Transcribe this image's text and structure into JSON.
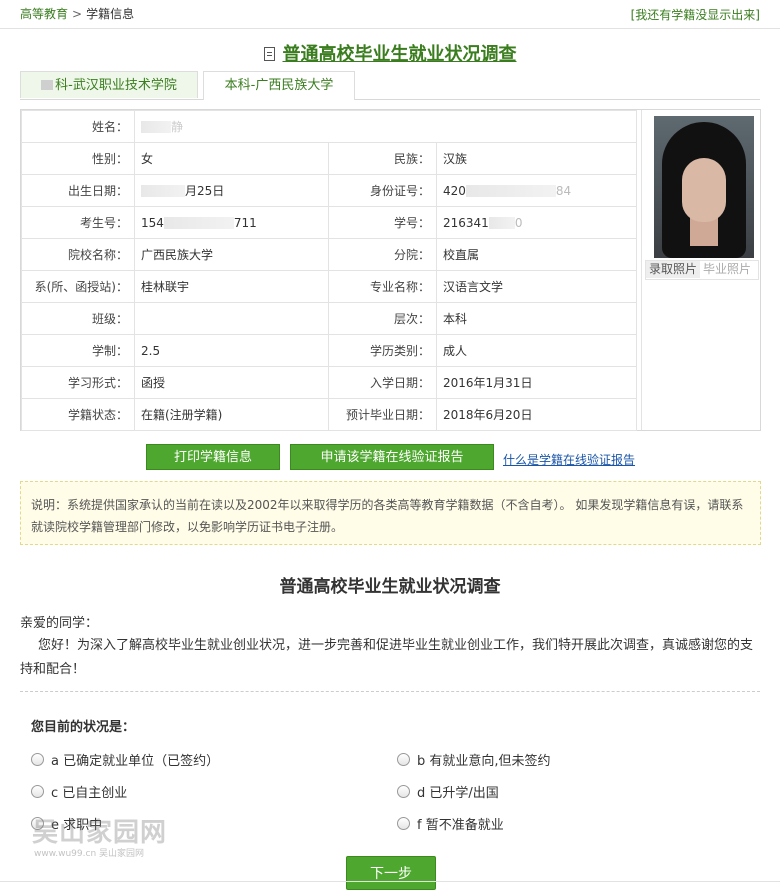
{
  "breadcrumb": {
    "root": "高等教育",
    "separator": ">",
    "current": "学籍信息"
  },
  "missing_link": "[我还有学籍没显示出来]",
  "page_title": "普通高校毕业生就业状况调查",
  "tabs": [
    {
      "label": "科-武汉职业技术学院"
    },
    {
      "label": "本科-广西民族大学"
    }
  ],
  "info": {
    "name_label": "姓名：",
    "name_value": "静",
    "gender_label": "性别：",
    "gender_value": "女",
    "ethnicity_label": "民族：",
    "ethnicity_value": "汉族",
    "birth_label": "出生日期：",
    "birth_value": "月25日",
    "id_label": "身份证号：",
    "id_prefix": "420",
    "id_suffix": "84",
    "exam_label": "考生号：",
    "exam_prefix": "154",
    "exam_suffix": "711",
    "student_no_label": "学号：",
    "student_no_prefix": "216341",
    "student_no_suffix": "0",
    "school_label": "院校名称：",
    "school_value": "广西民族大学",
    "branch_label": "分院：",
    "branch_value": "校直属",
    "dept_label": "系(所、函授站)：",
    "dept_value": "桂林联宇",
    "major_label": "专业名称：",
    "major_value": "汉语言文学",
    "class_label": "班级：",
    "class_value": "",
    "level_label": "层次：",
    "level_value": "本科",
    "duration_label": "学制：",
    "duration_value": "2.5",
    "edu_type_label": "学历类别：",
    "edu_type_value": "成人",
    "study_form_label": "学习形式：",
    "study_form_value": "函授",
    "enroll_label": "入学日期：",
    "enroll_value": "2016年1月31日",
    "status_label": "学籍状态：",
    "status_value": "在籍(注册学籍)",
    "grad_label": "预计毕业日期：",
    "grad_value": "2018年6月20日"
  },
  "photo_tabs": {
    "admission": "录取照片",
    "graduation": "毕业照片"
  },
  "buttons": {
    "print": "打印学籍信息",
    "verify": "申请该学籍在线验证报告",
    "what_is": "什么是学籍在线验证报告"
  },
  "notice": "说明：系统提供国家承认的当前在读以及2002年以来取得学历的各类高等教育学籍数据（不含自考）。 如果发现学籍信息有误，请联系就读院校学籍管理部门修改，以免影响学历证书电子注册。",
  "survey": {
    "title": "普通高校毕业生就业状况调查",
    "greeting": "亲爱的同学：",
    "intro": "您好！为深入了解高校毕业生就业创业状况，进一步完善和促进毕业生就业创业工作，我们特开展此次调查，真诚感谢您的支持和配合！",
    "question": "您目前的状况是：",
    "options": [
      {
        "label": "a 已确定就业单位（已签约）"
      },
      {
        "label": "b 有就业意向,但未签约"
      },
      {
        "label": "c 已自主创业"
      },
      {
        "label": "d 已升学/出国"
      },
      {
        "label": "e 求职中"
      },
      {
        "label": "f 暂不准备就业"
      }
    ],
    "next": "下一步"
  },
  "watermark": {
    "main": "吴山家园网",
    "sub": "www.wu99.cn 吴山家园网"
  }
}
